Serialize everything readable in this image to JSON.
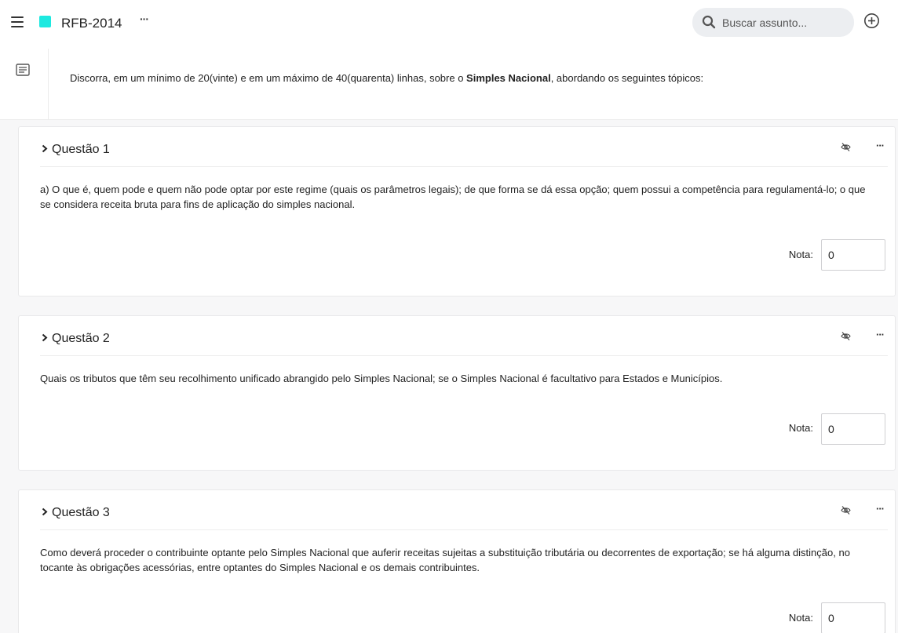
{
  "header": {
    "menu_icon": "hamburger-menu-icon",
    "doc_color": "#1de9e0",
    "title": "RFB-2014",
    "more_label": "···",
    "search_placeholder": "Buscar assunto...",
    "search_value": "",
    "add_icon": "plus-circle-icon"
  },
  "intro": {
    "icon": "notes-icon",
    "text_before": "Discorra, em um mínimo de 20(vinte) e em um máximo de 40(quarenta) linhas, sobre o ",
    "text_bold": "Simples Nacional",
    "text_after": ", abordando os seguintes tópicos:"
  },
  "questions": [
    {
      "title": "Questão 1",
      "body": "a)  O que é, quem pode e quem não pode optar por este regime (quais os parâmetros legais); de que forma se dá essa opção; quem possui a competência para regulamentá-lo; o que se considera receita bruta para fins de aplicação do simples nacional.",
      "nota_label": "Nota:",
      "nota_value": "0",
      "more_label": "···"
    },
    {
      "title": "Questão 2",
      "body": "Quais os tributos que têm seu recolhimento unificado abrangido pelo Simples Nacional; se o Simples Nacional é facultativo para Estados e Municípios.",
      "nota_label": "Nota:",
      "nota_value": "0",
      "more_label": "···"
    },
    {
      "title": "Questão 3",
      "body": "Como deverá proceder o contribuinte optante pelo Simples Nacional que auferir receitas sujeitas a substituição tributária ou decorrentes de exportação; se há alguma distinção, no tocante às obrigações acessórias, entre optantes do Simples Nacional e os demais contribuintes.",
      "nota_label": "Nota:",
      "nota_value": "0",
      "more_label": "···"
    }
  ]
}
